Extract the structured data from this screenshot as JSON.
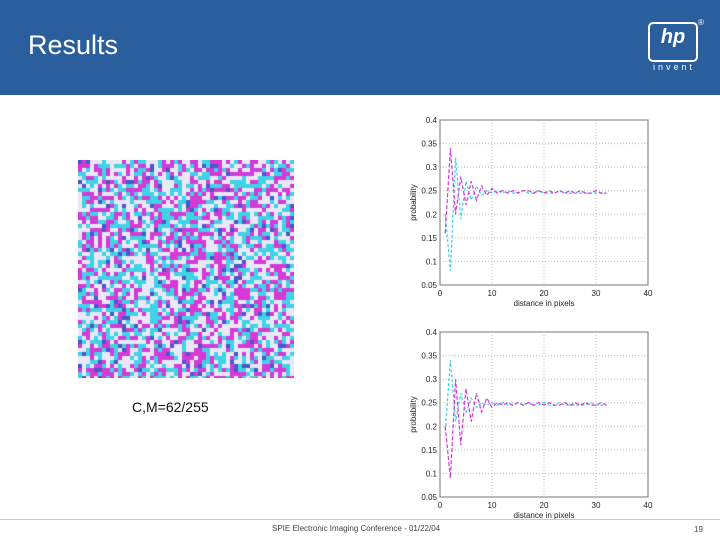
{
  "slide": {
    "title": "Results",
    "caption": "C,M=62/255",
    "footer": "SPIE Electronic Imaging Conference - 01/22/04",
    "page_number": "19",
    "logo": {
      "text": "hp",
      "tagline": "invent",
      "registered": "®"
    }
  },
  "colors": {
    "header": "#2a5e9c",
    "cyan": "#3fd3e6",
    "magenta": "#d63ad6",
    "pattern_bg": "#e8e8f6"
  },
  "chart_data": [
    {
      "type": "line",
      "xlabel": "distance in pixels",
      "ylabel": "probability",
      "xlim": [
        0,
        40
      ],
      "ylim": [
        0.05,
        0.4
      ],
      "xticks": [
        0,
        10,
        20,
        30,
        40
      ],
      "yticks": [
        0.05,
        0.1,
        0.15,
        0.2,
        0.25,
        0.3,
        0.35,
        0.4
      ],
      "yticklabels": [
        "0.05",
        "0.1",
        "0.15",
        "0.2",
        "0.25",
        "0.3",
        "0.35",
        "0.4"
      ],
      "grid": true,
      "x": [
        1,
        2,
        3,
        4,
        5,
        6,
        7,
        8,
        9,
        10,
        11,
        12,
        13,
        14,
        15,
        16,
        17,
        18,
        19,
        20,
        21,
        22,
        23,
        24,
        25,
        26,
        27,
        28,
        29,
        30,
        31,
        32
      ],
      "series": [
        {
          "color": "#3fd3e6",
          "dash": "3,2",
          "values": [
            0.2,
            0.08,
            0.32,
            0.19,
            0.27,
            0.23,
            0.26,
            0.24,
            0.25,
            0.245,
            0.25,
            0.245,
            0.25,
            0.245,
            0.245,
            0.25,
            0.245,
            0.245,
            0.25,
            0.245,
            0.245,
            0.245,
            0.25,
            0.245,
            0.245,
            0.245,
            0.245,
            0.245,
            0.245,
            0.245,
            0.245,
            0.245
          ]
        },
        {
          "color": "#d63ad6",
          "dash": "4,2",
          "values": [
            0.16,
            0.34,
            0.2,
            0.28,
            0.22,
            0.27,
            0.23,
            0.26,
            0.24,
            0.255,
            0.245,
            0.25,
            0.245,
            0.25,
            0.245,
            0.25,
            0.25,
            0.245,
            0.25,
            0.245,
            0.25,
            0.245,
            0.25,
            0.245,
            0.25,
            0.245,
            0.25,
            0.245,
            0.245,
            0.25,
            0.245,
            0.245
          ]
        }
      ]
    },
    {
      "type": "line",
      "xlabel": "distance in pixels",
      "ylabel": "probability",
      "xlim": [
        0,
        40
      ],
      "ylim": [
        0.05,
        0.4
      ],
      "xticks": [
        0,
        10,
        20,
        30,
        40
      ],
      "yticks": [
        0.05,
        0.1,
        0.15,
        0.2,
        0.25,
        0.3,
        0.35,
        0.4
      ],
      "yticklabels": [
        "0.05",
        "0.1",
        "0.15",
        "0.2",
        "0.25",
        "0.3",
        "0.35",
        "0.4"
      ],
      "grid": true,
      "x": [
        1,
        2,
        3,
        4,
        5,
        6,
        7,
        8,
        9,
        10,
        11,
        12,
        13,
        14,
        15,
        16,
        17,
        18,
        19,
        20,
        21,
        22,
        23,
        24,
        25,
        26,
        27,
        28,
        29,
        30,
        31,
        32
      ],
      "series": [
        {
          "color": "#3fd3e6",
          "dash": "3,2",
          "values": [
            0.19,
            0.34,
            0.21,
            0.27,
            0.23,
            0.26,
            0.24,
            0.25,
            0.245,
            0.25,
            0.245,
            0.25,
            0.245,
            0.245,
            0.25,
            0.245,
            0.25,
            0.245,
            0.245,
            0.25,
            0.245,
            0.245,
            0.25,
            0.245,
            0.245,
            0.245,
            0.245,
            0.245,
            0.25,
            0.245,
            0.245,
            0.245
          ]
        },
        {
          "color": "#d63ad6",
          "dash": "4,2",
          "values": [
            0.2,
            0.09,
            0.3,
            0.16,
            0.28,
            0.21,
            0.27,
            0.23,
            0.26,
            0.24,
            0.25,
            0.245,
            0.25,
            0.245,
            0.25,
            0.245,
            0.25,
            0.245,
            0.25,
            0.245,
            0.25,
            0.245,
            0.245,
            0.25,
            0.245,
            0.25,
            0.245,
            0.25,
            0.245,
            0.245,
            0.25,
            0.245
          ]
        }
      ]
    }
  ]
}
